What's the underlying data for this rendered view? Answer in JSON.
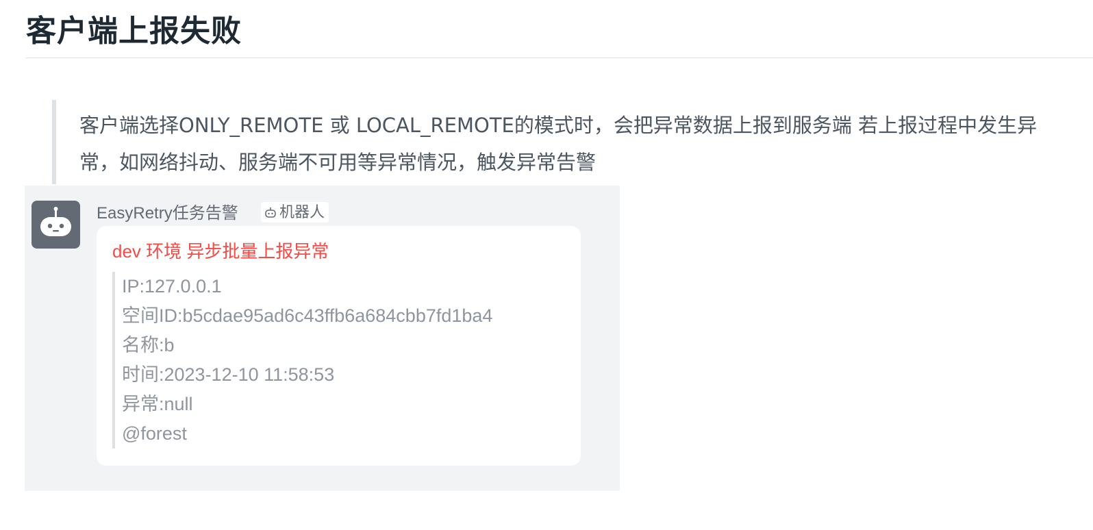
{
  "heading": "客户端上报失败",
  "quote": {
    "line1": "客户端选择ONLY_REMOTE 或 LOCAL_REMOTE的模式时，会把异常数据上报到服务端 若上报过程中发生异",
    "line2": "常，如网络抖动、服务端不可用等异常情况，触发异常告警"
  },
  "screenshot": {
    "sender": "EasyRetry任务告警",
    "bot_tag": "机器人",
    "card": {
      "title": "dev 环境 异步批量上报异常",
      "rows": [
        "IP:127.0.0.1",
        "空间ID:b5cdae95ad6c43ffb6a684cbb7fd1ba4",
        "名称:b",
        "时间:2023-12-10 11:58:53",
        "异常:null",
        "@forest"
      ]
    }
  },
  "colors": {
    "title_red": "#f54a45",
    "avatar_bg": "#646a73",
    "panel_bg": "#f2f3f5"
  },
  "icons": {
    "avatar": "robot-icon",
    "tag": "robot-icon"
  }
}
